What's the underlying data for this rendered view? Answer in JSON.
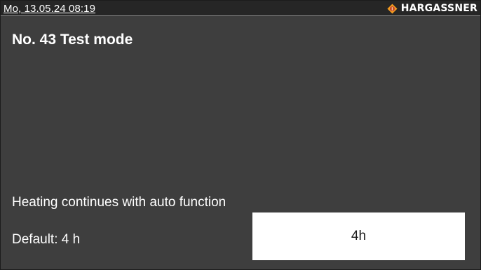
{
  "status_bar": {
    "datetime": "Mo, 13.05.24 08:19",
    "brand": "HARGASSNER",
    "brand_icon": "hargassner-logo-icon",
    "brand_color": "#f29a1f"
  },
  "screen": {
    "title": "No. 43 Test mode",
    "description": "Heating continues with auto function",
    "default_label": "Default: 4 h",
    "value": "4h"
  },
  "colors": {
    "background": "#3e3e3e",
    "status_bar": "#262626",
    "text": "#ffffff",
    "value_field": "#ffffff"
  }
}
